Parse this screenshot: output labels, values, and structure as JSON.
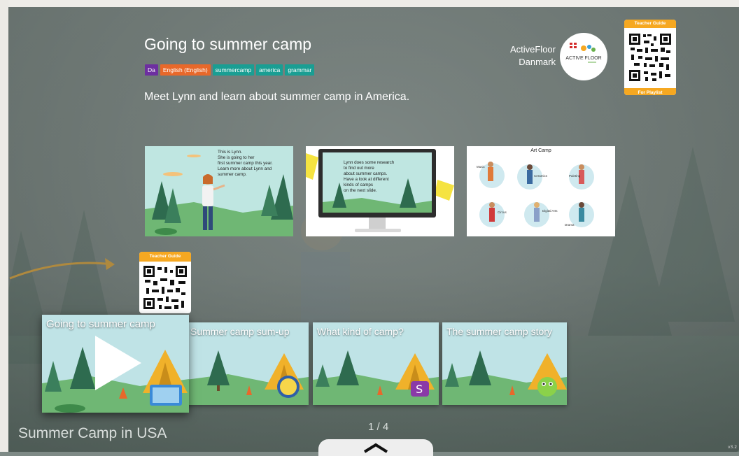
{
  "activity": {
    "title": "Going to summer camp",
    "description": "Meet Lynn and learn about summer camp in America.",
    "tags": [
      {
        "label": "Da",
        "color": "#6d2fa0"
      },
      {
        "label": "English (English)",
        "color": "#e8682a"
      },
      {
        "label": "summercamp",
        "color": "#1a9e93"
      },
      {
        "label": "america",
        "color": "#1a9e93"
      },
      {
        "label": "grammar",
        "color": "#1a9e93"
      }
    ]
  },
  "publisher": {
    "line1": "ActiveFloor",
    "line2": "Danmark",
    "logo_text": "ACTIVE FLOOR"
  },
  "qr_top": {
    "header": "Teacher Guide",
    "footer": "For Playlist"
  },
  "qr_left": {
    "header": "Teacher Guide"
  },
  "slides": [
    {
      "text": "This is Lynn.\nShe is going to her\nfirst summer camp this year.\nLearn more about Lynn and\nsummer camp."
    },
    {
      "text": "Lynn does some research\nto find out more\nabout summer camps.\nHave a look at different\nkinds of camps\non the next slide."
    },
    {
      "title": "Art Camp",
      "labels": [
        "Music",
        "Ceramics",
        "Painting",
        "Circus",
        "Digital Arts",
        "Drama"
      ]
    }
  ],
  "cards": [
    {
      "title": "Going to summer camp"
    },
    {
      "title": "Summer camp sum-up"
    },
    {
      "title": "What kind of camp?"
    },
    {
      "title": "The summer camp story"
    }
  ],
  "playlist": {
    "title": "Summer Camp in USA",
    "pager": "1 / 4"
  },
  "version": "v3.2",
  "colors": {
    "accent": "#f6a821",
    "teal": "#1a9e93"
  }
}
